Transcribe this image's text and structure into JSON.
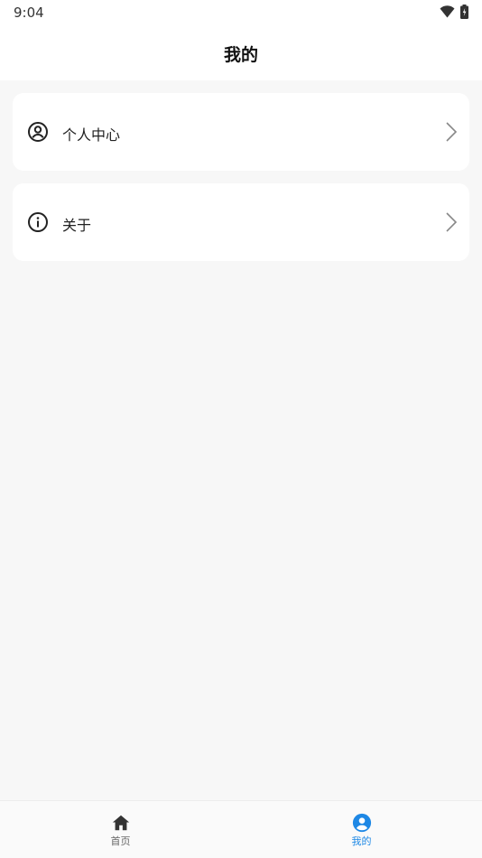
{
  "status_bar": {
    "time": "9:04"
  },
  "header": {
    "title": "我的"
  },
  "menu": {
    "items": [
      {
        "label": "个人中心",
        "icon": "user-circle-icon"
      },
      {
        "label": "关于",
        "icon": "info-icon"
      }
    ]
  },
  "tabbar": {
    "tabs": [
      {
        "label": "首页",
        "icon": "home-icon",
        "active": false
      },
      {
        "label": "我的",
        "icon": "user-icon",
        "active": true
      }
    ],
    "active_color": "#1e88e5",
    "inactive_color": "#666666"
  }
}
